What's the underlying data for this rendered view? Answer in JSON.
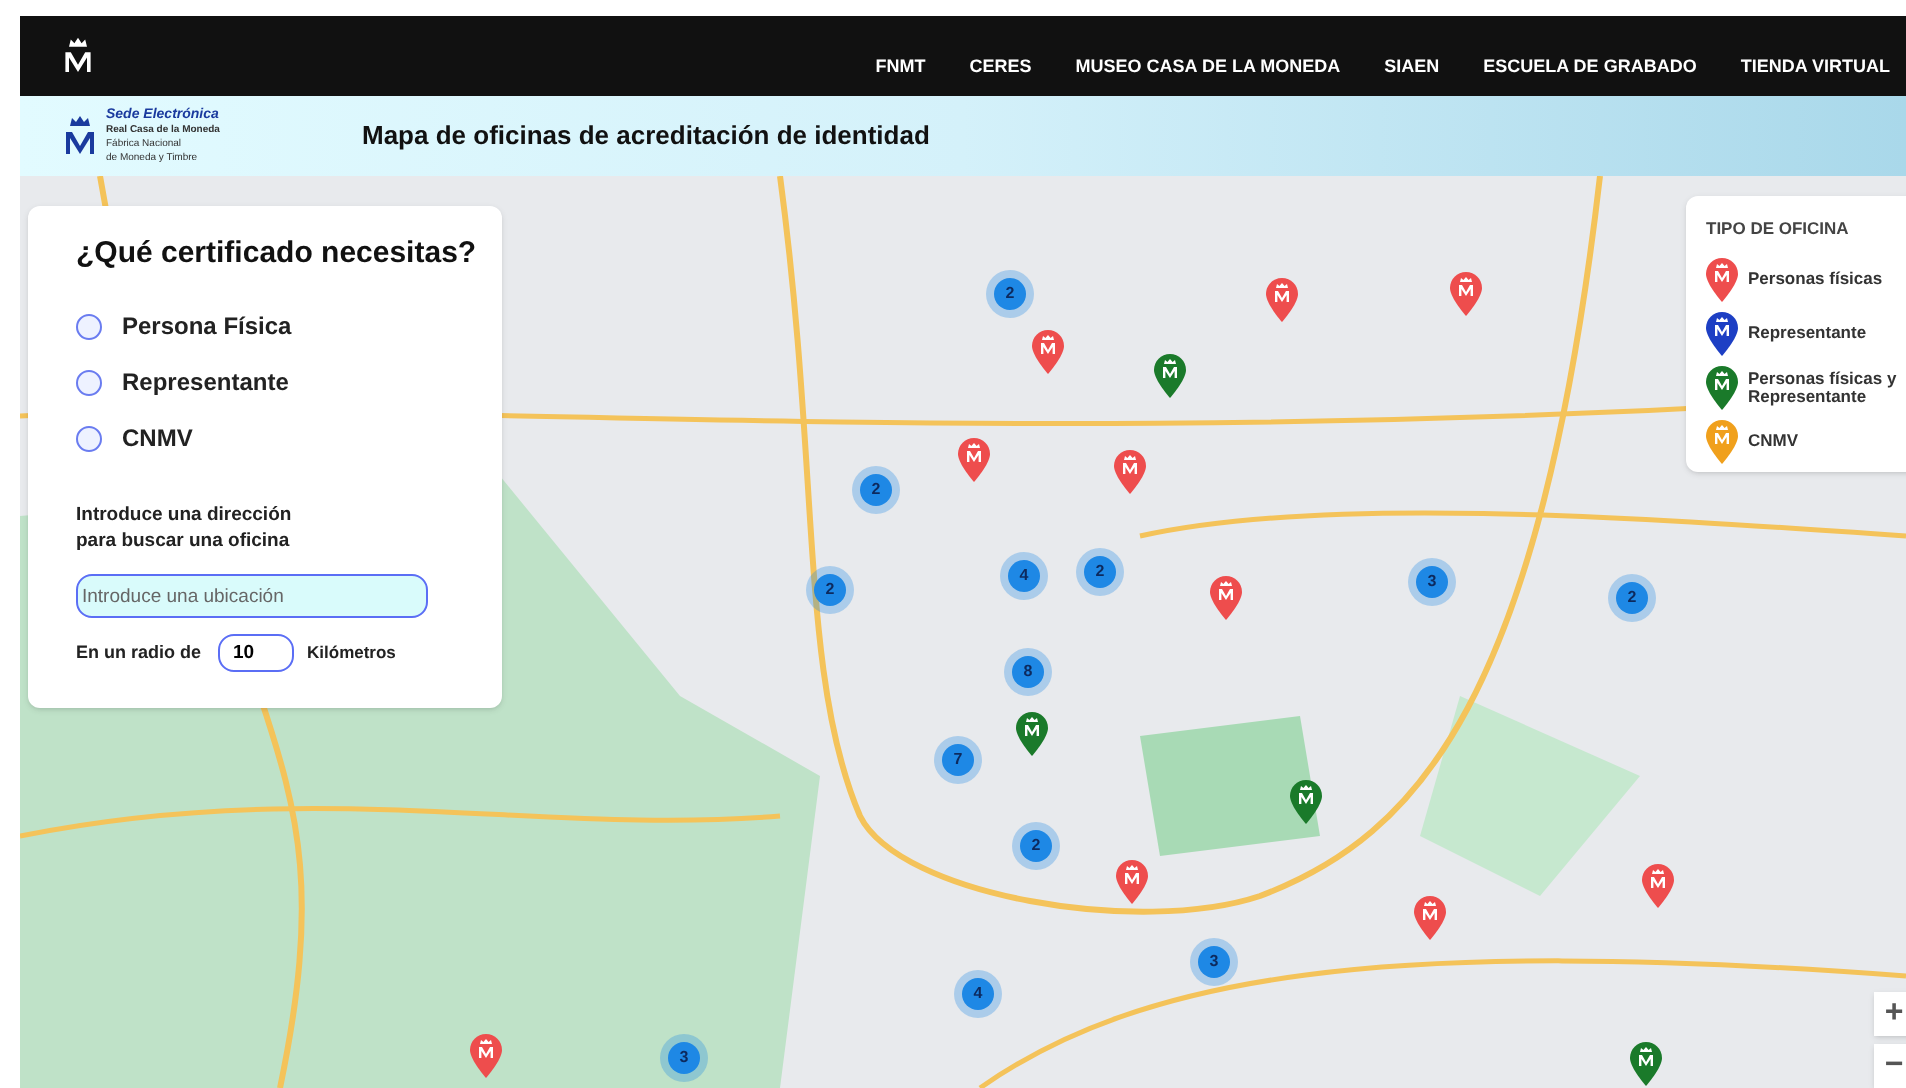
{
  "top_nav": {
    "links": [
      "FNMT",
      "CERES",
      "MUSEO CASA DE LA MONEDA",
      "SIAEN",
      "ESCUELA DE GRABADO",
      "TIENDA VIRTUAL"
    ]
  },
  "banner": {
    "brand_title": "Sede Electrónica",
    "brand_lines": [
      "Real Casa de la Moneda",
      "Fábrica Nacional",
      "de Moneda y Timbre"
    ],
    "page_title": "Mapa de oficinas de acreditación de identidad"
  },
  "search_panel": {
    "title": "¿Qué certificado necesitas?",
    "options": [
      {
        "label": "Persona Física",
        "selected": false
      },
      {
        "label": "Representante",
        "selected": false
      },
      {
        "label": "CNMV",
        "selected": false
      }
    ],
    "address_label_lines": [
      "Introduce una dirección",
      "para buscar una oficina"
    ],
    "address_placeholder": "Introduce una ubicación",
    "radius_label": "En un radio de",
    "radius_value": "10",
    "radius_unit": "Kilómetros"
  },
  "legend": {
    "title": "TIPO DE OFICINA",
    "items": [
      {
        "label": "Personas físicas",
        "color": "#ee4d4d"
      },
      {
        "label": "Representante",
        "color": "#1d3fc4"
      },
      {
        "label": "Personas físicas y Representante",
        "color": "#1a7a2a"
      },
      {
        "label": "CNMV",
        "color": "#f0a01c"
      }
    ]
  },
  "map": {
    "clusters": [
      {
        "count": "2"
      },
      {
        "count": "2"
      },
      {
        "count": "2"
      },
      {
        "count": "4"
      },
      {
        "count": "2"
      },
      {
        "count": "3"
      },
      {
        "count": "2"
      },
      {
        "count": "8"
      },
      {
        "count": "7"
      },
      {
        "count": "2"
      },
      {
        "count": "3"
      },
      {
        "count": "4"
      },
      {
        "count": "3"
      }
    ],
    "pins": [
      {
        "color": "#ee4d4d"
      },
      {
        "color": "#ee4d4d"
      },
      {
        "color": "#ee4d4d"
      },
      {
        "color": "#ee4d4d"
      },
      {
        "color": "#ee4d4d"
      },
      {
        "color": "#ee4d4d"
      },
      {
        "color": "#ee4d4d"
      },
      {
        "color": "#ee4d4d"
      },
      {
        "color": "#ee4d4d"
      },
      {
        "color": "#ee4d4d"
      },
      {
        "color": "#1a7a2a"
      },
      {
        "color": "#1a7a2a"
      },
      {
        "color": "#1a7a2a"
      },
      {
        "color": "#1a7a2a"
      }
    ],
    "zoom_controls": [
      "+",
      "−"
    ]
  }
}
